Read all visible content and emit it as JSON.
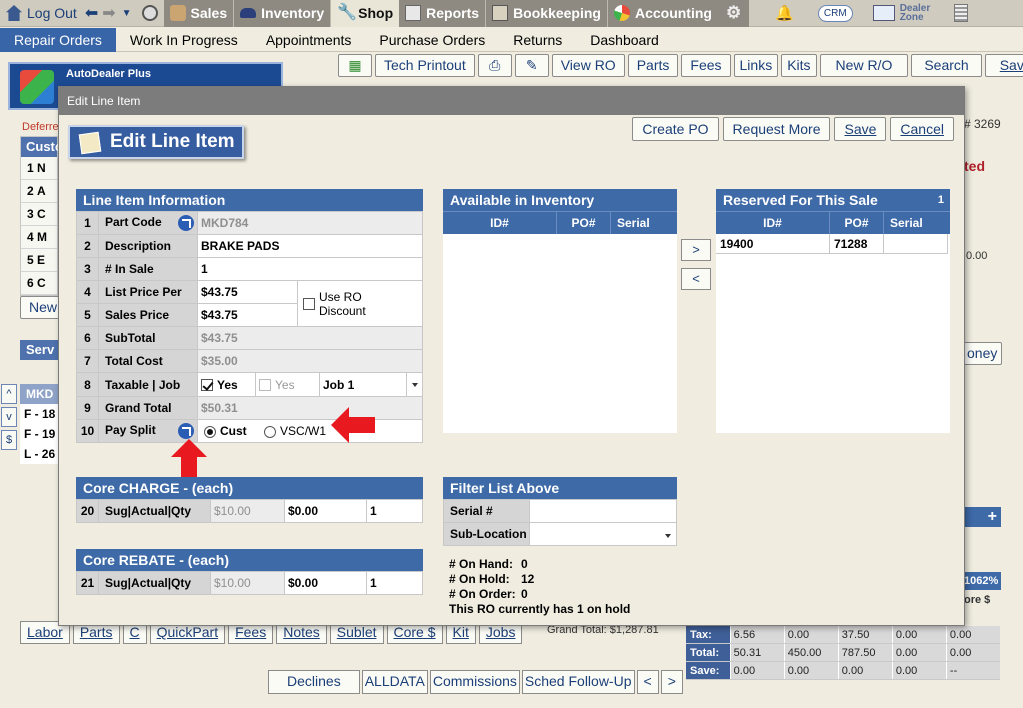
{
  "topnav": {
    "logout": "Log Out",
    "sales": "Sales",
    "inventory": "Inventory",
    "shop": "Shop",
    "reports": "Reports",
    "bookkeeping": "Bookkeeping",
    "accounting": "Accounting",
    "crm": "CRM",
    "dealer_zone_1": "Dealer",
    "dealer_zone_2": "Zone"
  },
  "menubar": [
    "Repair Orders",
    "Work In Progress",
    "Appointments",
    "Purchase Orders",
    "Returns",
    "Dashboard"
  ],
  "background": {
    "logo_title": "AutoDealer Plus",
    "toolbar": [
      "Tech Printout",
      "View RO",
      "Parts",
      "Fees",
      "Links",
      "Kits",
      "New R/O",
      "Search",
      "Save"
    ],
    "deferred_label": "Deferre",
    "cust_header": "Custo",
    "left_rows": [
      "1",
      "2",
      "3",
      "4",
      "5",
      "6"
    ],
    "left_letters": [
      "N",
      "A",
      "C",
      "M",
      "E",
      "C"
    ],
    "new_btn": "New",
    "serv_label": "Serv",
    "mkd_label": "MKD",
    "lines": [
      "F - 18",
      "F - 19",
      "L - 26"
    ],
    "ro_number_suffix": "# 3269",
    "red_suffix": "ted",
    "right_zero": "0.00",
    "money_btn": "oney",
    "pct_label": "1062%",
    "core_dollar": "ore $",
    "bottom_tabs": [
      "Labor",
      "Parts",
      "C",
      "QuickPart",
      "Fees",
      "Notes",
      "Sublet",
      "Core $",
      "Kit",
      "Jobs"
    ],
    "grand_total": "Grand Total: $1,287.81",
    "bottom_buttons": [
      "Declines",
      "ALLDATA",
      "Commissions",
      "Sched Follow-Up"
    ],
    "totals": [
      {
        "label": "Tax:",
        "cells": [
          "6.56",
          "0.00",
          "37.50",
          "0.00",
          "0.00"
        ]
      },
      {
        "label": "Total:",
        "cells": [
          "50.31",
          "450.00",
          "787.50",
          "0.00",
          "0.00"
        ]
      },
      {
        "label": "Save:",
        "cells": [
          "0.00",
          "0.00",
          "0.00",
          "0.00",
          "--"
        ]
      }
    ]
  },
  "modal": {
    "title": "Edit Line Item",
    "hero": "Edit Line Item",
    "buttons": [
      "Create PO",
      "Request More",
      "Save",
      "Cancel"
    ],
    "line_item": {
      "header": "Line Item Information",
      "rows": [
        {
          "num": "1",
          "label": "Part Code",
          "value": "MKD784"
        },
        {
          "num": "2",
          "label": "Description",
          "value": "BRAKE PADS"
        },
        {
          "num": "3",
          "label": "# In Sale",
          "value": "1"
        },
        {
          "num": "4",
          "label": "List Price Per",
          "value": "$43.75"
        },
        {
          "num": "5",
          "label": "Sales Price",
          "value": "$43.75"
        },
        {
          "num": "6",
          "label": "SubTotal",
          "value": "$43.75"
        },
        {
          "num": "7",
          "label": "Total Cost",
          "value": "$35.00"
        },
        {
          "num": "8",
          "label": "Taxable | Job",
          "value": ""
        },
        {
          "num": "9",
          "label": "Grand Total",
          "value": "$50.31"
        },
        {
          "num": "10",
          "label": "Pay Split",
          "value": ""
        }
      ],
      "use_ro_discount": "Use RO Discount",
      "taxable_yes": "Yes",
      "taxable_yes_disabled": "Yes",
      "job": "Job 1",
      "pay_cust": "Cust",
      "pay_vsc": "VSC/W1"
    },
    "available": {
      "header": "Available in Inventory",
      "columns": [
        "ID#",
        "PO#",
        "Serial"
      ]
    },
    "reserved": {
      "header": "Reserved For This Sale",
      "count": "1",
      "columns": [
        "ID#",
        "PO#",
        "Serial"
      ],
      "rows": [
        {
          "id": "19400",
          "po": "71288",
          "serial": ""
        }
      ]
    },
    "move_right": ">",
    "move_left": "<",
    "core_charge": {
      "header": "Core CHARGE - (each)",
      "num": "20",
      "label": "Sug|Actual|Qty",
      "sug": "$10.00",
      "actual": "$0.00",
      "qty": "1"
    },
    "core_rebate": {
      "header": "Core REBATE - (each)",
      "num": "21",
      "label": "Sug|Actual|Qty",
      "sug": "$10.00",
      "actual": "$0.00",
      "qty": "1"
    },
    "filter": {
      "header": "Filter List Above",
      "serial_label": "Serial #",
      "sublocation_label": "Sub-Location"
    },
    "stats": [
      {
        "k": "# On Hand:",
        "v": "0"
      },
      {
        "k": "# On Hold:",
        "v": "12"
      },
      {
        "k": "# On Order:",
        "v": "0"
      }
    ],
    "hold_note": "This RO currently has 1 on hold"
  }
}
